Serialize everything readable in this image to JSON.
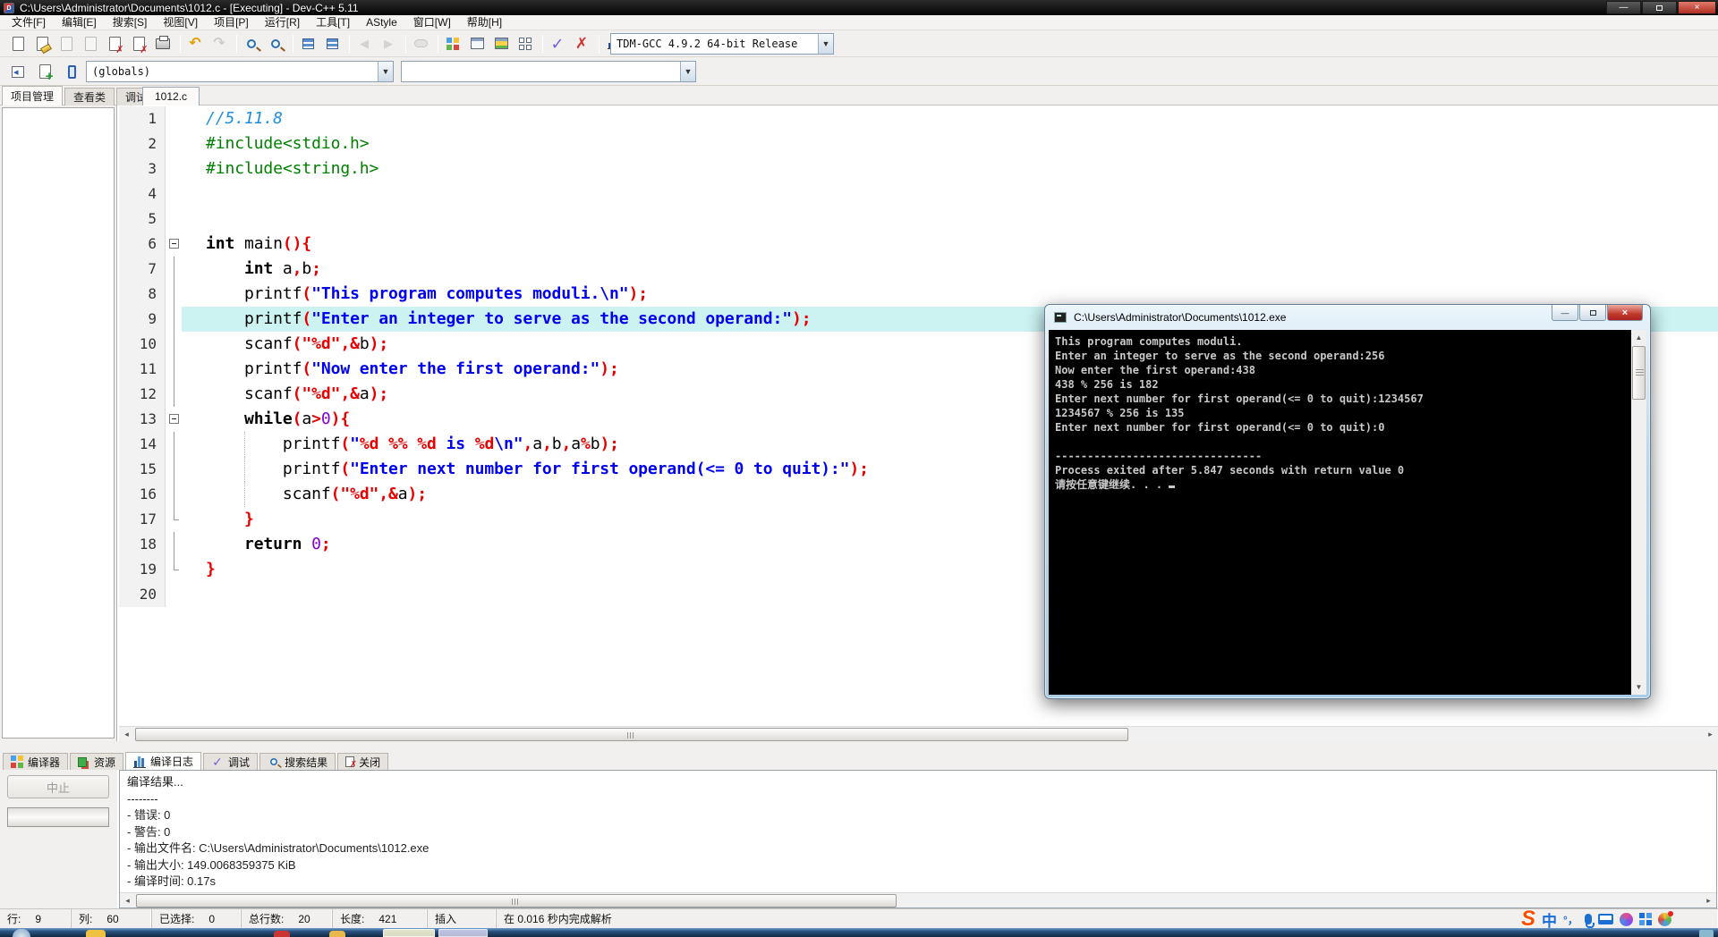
{
  "window": {
    "title": "C:\\Users\\Administrator\\Documents\\1012.c - [Executing] - Dev-C++ 5.11",
    "controls": {
      "minimize": "—",
      "maximize": "",
      "close": "×"
    }
  },
  "menu": {
    "items": [
      "文件[F]",
      "编辑[E]",
      "搜索[S]",
      "视图[V]",
      "项目[P]",
      "运行[R]",
      "工具[T]",
      "AStyle",
      "窗口[W]",
      "帮助[H]"
    ]
  },
  "toolbar": {
    "compiler_profile": "TDM-GCC 4.9.2 64-bit Release",
    "class_browser_scope": "(globals)",
    "member_select": "",
    "row1": [
      {
        "icon": "new-file"
      },
      {
        "icon": "open-file"
      },
      {
        "icon": "save",
        "disabled": true
      },
      {
        "icon": "save-all",
        "disabled": true
      },
      {
        "icon": "close-file"
      },
      {
        "icon": "close-all"
      },
      {
        "icon": "print"
      },
      "sep",
      {
        "icon": "undo"
      },
      {
        "icon": "redo",
        "disabled": true
      },
      "sep",
      {
        "icon": "find"
      },
      {
        "icon": "replace"
      },
      "sep",
      {
        "icon": "goto-line"
      },
      {
        "icon": "goto-function"
      },
      "sep",
      {
        "icon": "back",
        "disabled": true
      },
      {
        "icon": "forward",
        "disabled": true
      },
      "sep",
      {
        "icon": "breakpoint",
        "disabled": true
      },
      "sep",
      {
        "icon": "compile"
      },
      {
        "icon": "run"
      },
      {
        "icon": "compile-run"
      },
      {
        "icon": "rebuild"
      },
      "sep",
      {
        "icon": "debug-check"
      },
      {
        "icon": "abort-cross"
      },
      "sep",
      {
        "icon": "profile-chart"
      },
      {
        "icon": "delete-profile"
      }
    ],
    "row2": [
      {
        "icon": "new-project"
      },
      {
        "icon": "add-file"
      },
      {
        "icon": "remove-file"
      }
    ]
  },
  "left_panel": {
    "tabs": [
      {
        "label": "项目管理",
        "active": true
      },
      {
        "label": "查看类",
        "active": false
      },
      {
        "label": "调试",
        "active": false
      }
    ]
  },
  "editor": {
    "tab": "1012.c",
    "current_line": 9,
    "lines": [
      {
        "n": 1,
        "fold": "none",
        "segs": [
          [
            "cm",
            "//5.11.8"
          ]
        ]
      },
      {
        "n": 2,
        "fold": "none",
        "segs": [
          [
            "pp",
            "#include<stdio.h>"
          ]
        ]
      },
      {
        "n": 3,
        "fold": "none",
        "segs": [
          [
            "pp",
            "#include<string.h>"
          ]
        ]
      },
      {
        "n": 4,
        "fold": "none",
        "segs": []
      },
      {
        "n": 5,
        "fold": "none",
        "segs": []
      },
      {
        "n": 6,
        "fold": "start",
        "segs": [
          [
            "kw",
            "int"
          ],
          [
            "pl",
            " main"
          ],
          [
            "op",
            "(){"
          ]
        ]
      },
      {
        "n": 7,
        "fold": "line",
        "segs": [
          [
            "pl",
            "    "
          ],
          [
            "kw",
            "int"
          ],
          [
            "pl",
            " a"
          ],
          [
            "op",
            ","
          ],
          [
            "pl",
            "b"
          ],
          [
            "op",
            ";"
          ]
        ]
      },
      {
        "n": 8,
        "fold": "line",
        "segs": [
          [
            "pl",
            "    printf"
          ],
          [
            "op",
            "("
          ],
          [
            "st",
            "\"This program computes moduli.\\n\""
          ],
          [
            "op",
            ");"
          ]
        ]
      },
      {
        "n": 9,
        "fold": "line",
        "segs": [
          [
            "pl",
            "    printf"
          ],
          [
            "op",
            "("
          ],
          [
            "st",
            "\"Enter an integer to serve as the second operand:\""
          ],
          [
            "op",
            ");"
          ]
        ]
      },
      {
        "n": 10,
        "fold": "line",
        "segs": [
          [
            "pl",
            "    scanf"
          ],
          [
            "op",
            "("
          ],
          [
            "fm",
            "\"%d\""
          ],
          [
            "op",
            ",&"
          ],
          [
            "pl",
            "b"
          ],
          [
            "op",
            ");"
          ]
        ]
      },
      {
        "n": 11,
        "fold": "line",
        "segs": [
          [
            "pl",
            "    printf"
          ],
          [
            "op",
            "("
          ],
          [
            "st",
            "\"Now enter the first operand:\""
          ],
          [
            "op",
            ");"
          ]
        ]
      },
      {
        "n": 12,
        "fold": "line",
        "segs": [
          [
            "pl",
            "    scanf"
          ],
          [
            "op",
            "("
          ],
          [
            "fm",
            "\"%d\""
          ],
          [
            "op",
            ",&"
          ],
          [
            "pl",
            "a"
          ],
          [
            "op",
            ");"
          ]
        ]
      },
      {
        "n": 13,
        "fold": "start",
        "segs": [
          [
            "pl",
            "    "
          ],
          [
            "kw",
            "while"
          ],
          [
            "op",
            "("
          ],
          [
            "pl",
            "a"
          ],
          [
            "op",
            ">"
          ],
          [
            "nm",
            "0"
          ],
          [
            "op",
            "){"
          ]
        ]
      },
      {
        "n": 14,
        "fold": "line",
        "guide": true,
        "segs": [
          [
            "pl",
            "        printf"
          ],
          [
            "op",
            "("
          ],
          [
            "st",
            "\""
          ],
          [
            "fm",
            "%d"
          ],
          [
            "st",
            " "
          ],
          [
            "fm",
            "%%"
          ],
          [
            "st",
            " "
          ],
          [
            "fm",
            "%d"
          ],
          [
            "st",
            " is "
          ],
          [
            "fm",
            "%d"
          ],
          [
            "st",
            "\\n\""
          ],
          [
            "op",
            ","
          ],
          [
            "pl",
            "a"
          ],
          [
            "op",
            ","
          ],
          [
            "pl",
            "b"
          ],
          [
            "op",
            ","
          ],
          [
            "pl",
            "a"
          ],
          [
            "op",
            "%"
          ],
          [
            "pl",
            "b"
          ],
          [
            "op",
            ");"
          ]
        ]
      },
      {
        "n": 15,
        "fold": "line",
        "guide": true,
        "segs": [
          [
            "pl",
            "        printf"
          ],
          [
            "op",
            "("
          ],
          [
            "st",
            "\"Enter next number for first operand(<= 0 to quit):\""
          ],
          [
            "op",
            ");"
          ]
        ]
      },
      {
        "n": 16,
        "fold": "line",
        "guide": true,
        "segs": [
          [
            "pl",
            "        scanf"
          ],
          [
            "op",
            "("
          ],
          [
            "fm",
            "\"%d\""
          ],
          [
            "op",
            ",&"
          ],
          [
            "pl",
            "a"
          ],
          [
            "op",
            ");"
          ]
        ]
      },
      {
        "n": 17,
        "fold": "end",
        "segs": [
          [
            "pl",
            "    "
          ],
          [
            "op",
            "}"
          ]
        ]
      },
      {
        "n": 18,
        "fold": "line",
        "segs": [
          [
            "pl",
            "    "
          ],
          [
            "kw",
            "return"
          ],
          [
            "pl",
            " "
          ],
          [
            "nm",
            "0"
          ],
          [
            "op",
            ";"
          ]
        ]
      },
      {
        "n": 19,
        "fold": "end",
        "segs": [
          [
            "op",
            "}"
          ]
        ]
      },
      {
        "n": 20,
        "fold": "none",
        "segs": []
      }
    ]
  },
  "console": {
    "title": "C:\\Users\\Administrator\\Documents\\1012.exe",
    "lines": [
      "This program computes moduli.",
      "Enter an integer to serve as the second operand:256",
      "Now enter the first operand:438",
      "438 % 256 is 182",
      "Enter next number for first operand(<= 0 to quit):1234567",
      "1234567 % 256 is 135",
      "Enter next number for first operand(<= 0 to quit):0",
      "",
      "--------------------------------",
      "Process exited after 5.847 seconds with return value 0",
      "请按任意键继续. . . "
    ],
    "cursor_visible": true,
    "controls": {
      "minimize": "—",
      "maximize": "",
      "close": "×"
    }
  },
  "bottom_panel": {
    "tabs": [
      {
        "label": "编译器",
        "icon": "grid4",
        "active": false
      },
      {
        "label": "资源",
        "icon": "layers",
        "active": false
      },
      {
        "label": "编译日志",
        "icon": "chart",
        "active": true
      },
      {
        "label": "调试",
        "icon": "check",
        "active": false
      },
      {
        "label": "搜索结果",
        "icon": "mag",
        "active": false
      },
      {
        "label": "关闭",
        "icon": "pagex",
        "active": false
      }
    ],
    "abort_label": "中止",
    "log_lines": [
      "编译结果...",
      "--------",
      "- 错误: 0",
      "- 警告: 0",
      "- 输出文件名: C:\\Users\\Administrator\\Documents\\1012.exe",
      "- 输出大小: 149.0068359375 KiB",
      "- 编译时间: 0.17s"
    ]
  },
  "status_bar": {
    "items": [
      {
        "label": "行:",
        "value": "9"
      },
      {
        "label": "列:",
        "value": "60"
      },
      {
        "label": "已选择:",
        "value": "0"
      },
      {
        "label": "总行数:",
        "value": "20"
      },
      {
        "label": "长度:",
        "value": "421"
      },
      {
        "label": "插入",
        "value": ""
      },
      {
        "label": "在 0.016 秒内完成解析",
        "value": ""
      }
    ]
  },
  "ime": {
    "icons": [
      {
        "name": "sogou-logo",
        "text": "S"
      },
      {
        "name": "chinese-mode",
        "text": "中"
      },
      {
        "name": "punctuation",
        "text": "°，"
      },
      {
        "name": "microphone",
        "text": ""
      },
      {
        "name": "soft-keyboard",
        "text": ""
      },
      {
        "name": "skin-brush",
        "text": ""
      },
      {
        "name": "toolbox",
        "text": ""
      },
      {
        "name": "effects",
        "text": ""
      }
    ]
  },
  "colors": {
    "string_blue": "#0000ee",
    "format_red": "#e80000",
    "preproc_green": "#008000",
    "number_purple": "#8400d4",
    "comment_blue": "#1e8fe0",
    "current_line": "#ccf2f2",
    "console_bg": "#000000",
    "console_text": "#c8c8c8"
  }
}
